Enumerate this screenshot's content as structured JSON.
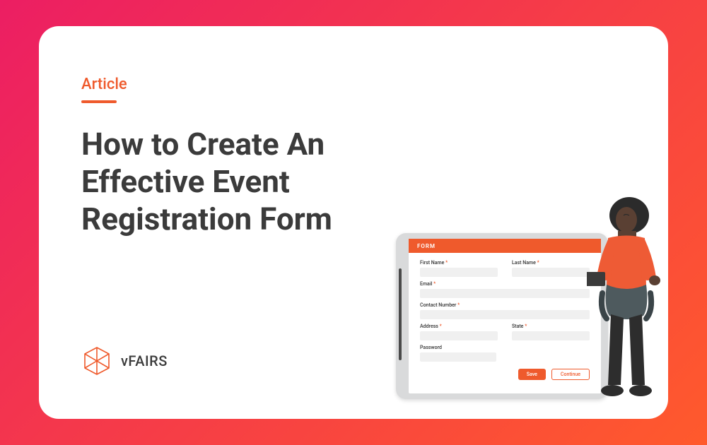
{
  "category": "Article",
  "title": "How to Create An Effective Event Registration Form",
  "brand": "vFAIRS",
  "form": {
    "header": "FORM",
    "first_name_label": "First Name",
    "last_name_label": "Last Name",
    "email_label": "Email",
    "contact_label": "Contact Number",
    "address_label": "Address",
    "state_label": "State",
    "password_label": "Password",
    "save_label": "Save",
    "continue_label": "Continue"
  }
}
